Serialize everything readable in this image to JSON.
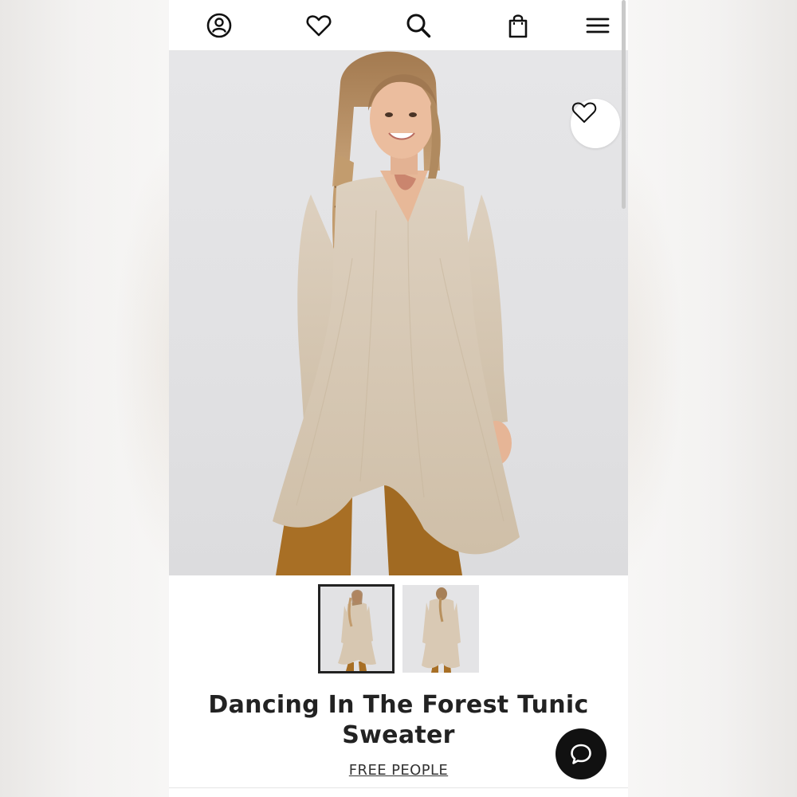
{
  "nav": {
    "icons": [
      "account-icon",
      "wishlist-heart-icon",
      "search-icon",
      "shopping-bag-icon",
      "menu-icon"
    ]
  },
  "product": {
    "title": "Dancing In The Forest Tunic Sweater",
    "brand": "FREE PEOPLE",
    "images": [
      "front-view",
      "back-view"
    ],
    "selected_image_index": 0,
    "wishlist_icon": "heart-outline-icon"
  },
  "chat": {
    "icon": "chat-bubble-icon"
  },
  "colors": {
    "page_bg": "#ffffff",
    "text": "#222222",
    "chat_button": "#111111",
    "sweater": "#d8c8b2",
    "pants": "#a86f25"
  }
}
